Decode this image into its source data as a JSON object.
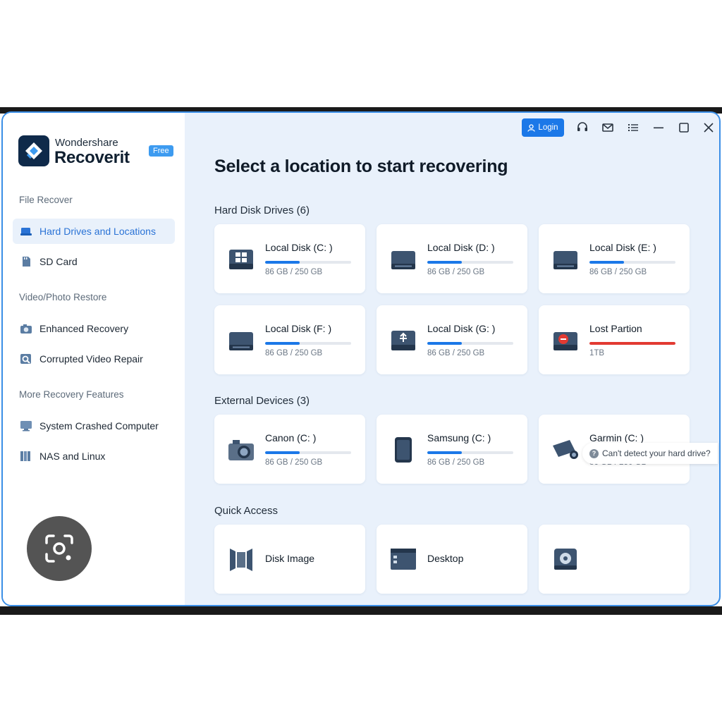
{
  "app": {
    "brand_top": "Wondershare",
    "brand_main": "Recoverit",
    "badge": "Free",
    "accent": "#1b78e8"
  },
  "toolbar": {
    "login_label": "Login",
    "icons": [
      "headset-icon",
      "mail-icon",
      "menu-list-icon",
      "minimize-icon",
      "maximize-icon",
      "close-icon"
    ]
  },
  "sidebar": {
    "sections": [
      {
        "label": "File Recover"
      },
      {
        "label": "Video/Photo Restore"
      },
      {
        "label": "More Recovery Features"
      }
    ],
    "items": [
      {
        "label": "Hard Drives and Locations",
        "active": true,
        "icon": "hard-drive-icon"
      },
      {
        "label": "SD Card",
        "active": false,
        "icon": "sd-card-icon"
      },
      {
        "label": "Enhanced Recovery",
        "active": false,
        "icon": "camera-icon"
      },
      {
        "label": "Corrupted Video Repair",
        "active": false,
        "icon": "video-repair-icon"
      },
      {
        "label": "System Crashed Computer",
        "active": false,
        "icon": "monitor-icon"
      },
      {
        "label": "NAS and Linux",
        "active": false,
        "icon": "server-icon"
      }
    ]
  },
  "main": {
    "title": "Select a location to start recovering",
    "groups": [
      {
        "title": "Hard Disk Drives (6)",
        "cards": [
          {
            "name": "Local Disk (C: )",
            "size": "86 GB / 250 GB",
            "used": 0.4,
            "icon": "windows-drive-icon"
          },
          {
            "name": "Local Disk (D: )",
            "size": "86 GB / 250 GB",
            "used": 0.4,
            "icon": "drive-icon"
          },
          {
            "name": "Local Disk (E: )",
            "size": "86 GB / 250 GB",
            "used": 0.4,
            "icon": "drive-icon"
          },
          {
            "name": "Local Disk (F: )",
            "size": "86 GB / 250 GB",
            "used": 0.4,
            "icon": "drive-icon"
          },
          {
            "name": "Local Disk (G: )",
            "size": "86 GB / 250 GB",
            "used": 0.4,
            "icon": "usb-drive-icon"
          },
          {
            "name": "Lost Partion",
            "size": "1TB",
            "used": 1.0,
            "icon": "lost-partition-icon"
          }
        ]
      },
      {
        "title": "External Devices (3)",
        "cards": [
          {
            "name": "Canon (C: )",
            "size": "86 GB / 250 GB",
            "used": 0.4,
            "icon": "camera-device-icon"
          },
          {
            "name": "Samsung (C: )",
            "size": "86 GB / 250 GB",
            "used": 0.4,
            "icon": "phone-icon"
          },
          {
            "name": "Garmin (C: )",
            "size": "86 GB / 250 GB",
            "used": 0.4,
            "icon": "dashcam-icon"
          }
        ]
      },
      {
        "title": "Quick Access",
        "cards": [
          {
            "name": "Disk Image",
            "icon": "disk-image-icon"
          },
          {
            "name": "Desktop",
            "icon": "desktop-icon"
          },
          {
            "name": "",
            "icon": "select-folder-icon"
          }
        ]
      }
    ],
    "tooltip": "Can't detect your hard drive?"
  },
  "colors": {
    "used_bar": "#1b78e8",
    "lost_bar": "#e23a32",
    "main_bg": "#e9f1fb"
  }
}
